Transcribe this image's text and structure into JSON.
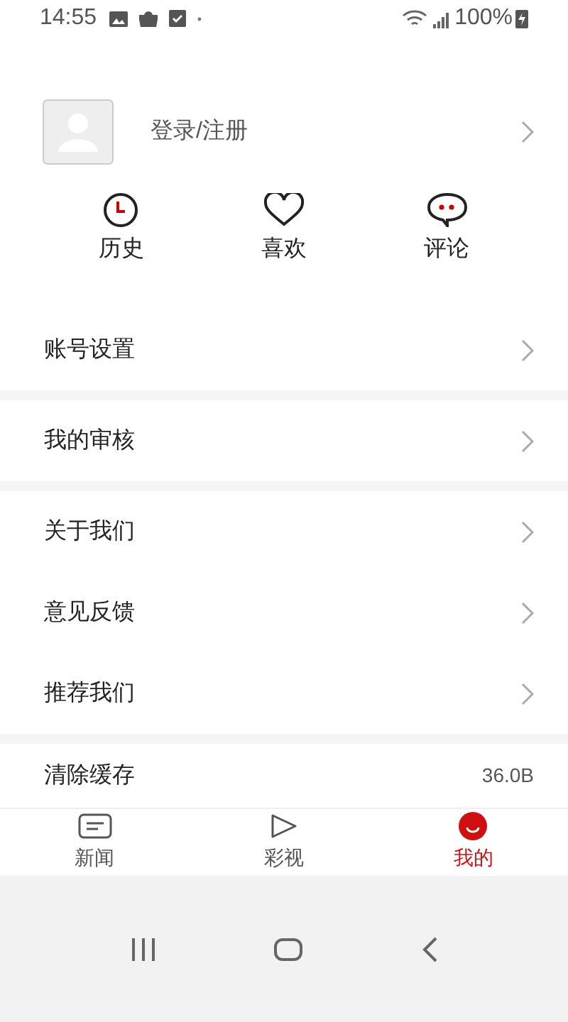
{
  "status_bar": {
    "time": "14:55",
    "battery": "100%"
  },
  "profile": {
    "label": "登录/注册"
  },
  "quick_actions": [
    {
      "kind": "history",
      "label": "历史"
    },
    {
      "kind": "like",
      "label": "喜欢"
    },
    {
      "kind": "comment",
      "label": "评论"
    }
  ],
  "menu_groups": [
    [
      {
        "kind": "link",
        "label": "账号设置"
      }
    ],
    [
      {
        "kind": "link",
        "label": "我的审核"
      }
    ],
    [
      {
        "kind": "link",
        "label": "关于我们"
      },
      {
        "kind": "link",
        "label": "意见反馈"
      },
      {
        "kind": "link",
        "label": "推荐我们"
      }
    ],
    [
      {
        "kind": "value",
        "label": "清除缓存",
        "value": "36.0B"
      }
    ]
  ],
  "tabs": [
    {
      "kind": "news",
      "label": "新闻",
      "selected": false
    },
    {
      "kind": "video",
      "label": "彩视",
      "selected": false
    },
    {
      "kind": "me",
      "label": "我的",
      "selected": true
    }
  ]
}
